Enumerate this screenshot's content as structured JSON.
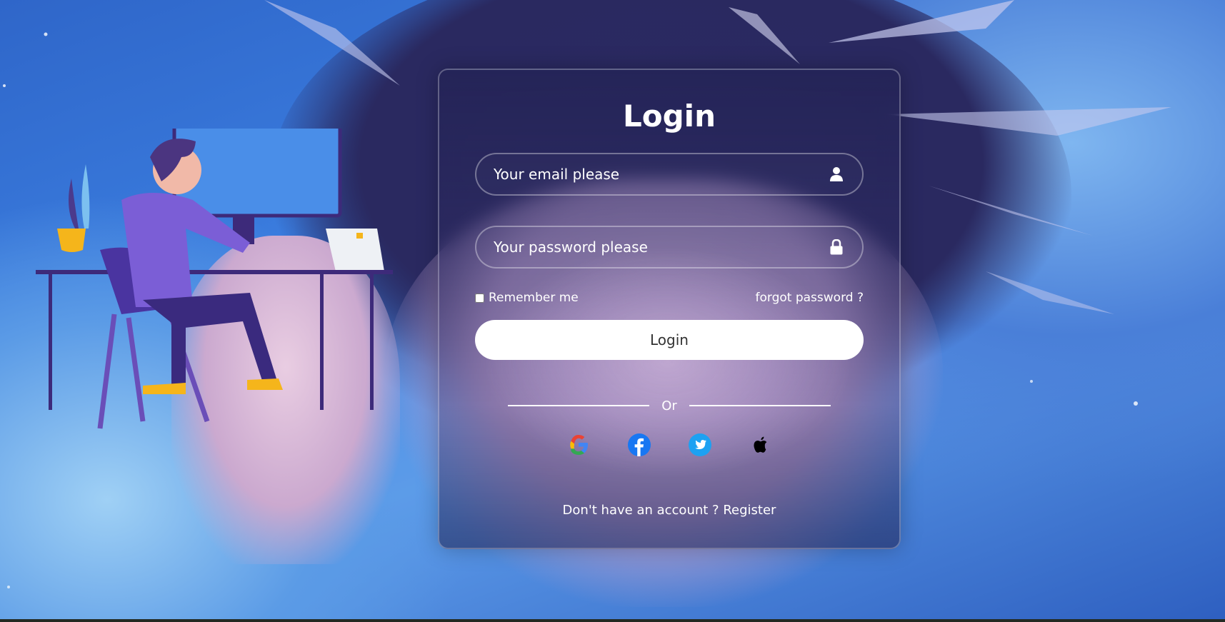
{
  "login_card": {
    "title": "Login",
    "email": {
      "placeholder": "Your email please",
      "icon": "user-icon"
    },
    "password": {
      "placeholder": "Your password please",
      "icon": "lock-icon"
    },
    "remember_label": "Remember me",
    "forgot_label": "forgot password ?",
    "login_button_label": "Login",
    "divider_text": "Or",
    "social_icons": [
      "google-icon",
      "facebook-icon",
      "twitter-icon",
      "apple-icon"
    ],
    "register_prompt": "Don't have an account ?",
    "register_link": "Register"
  },
  "colors": {
    "accent_white": "#ffffff",
    "button_text": "#333333",
    "facebook": "#1877f2",
    "twitter": "#1da1f2",
    "apple": "#000000"
  }
}
